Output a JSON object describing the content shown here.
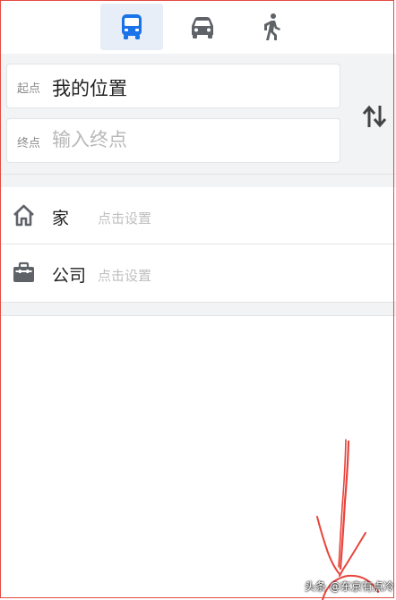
{
  "modes": [
    {
      "name": "bus",
      "icon": "bus-icon",
      "active": true
    },
    {
      "name": "car",
      "icon": "car-icon",
      "active": false
    },
    {
      "name": "walk",
      "icon": "walk-icon",
      "active": false
    }
  ],
  "route": {
    "start_label": "起点",
    "start_value": "我的位置",
    "end_label": "终点",
    "end_placeholder": "输入终点",
    "swap_icon": "swap-icon"
  },
  "shortcuts": [
    {
      "title": "家",
      "hint": "点击设置",
      "icon": "home-icon"
    },
    {
      "title": "公司",
      "hint": "点击设置",
      "icon": "briefcase-icon"
    }
  ],
  "watermark": "头条 @东京有点冷",
  "colors": {
    "accent": "#1a73e8",
    "icon_gray": "#5f6368",
    "annotation_red": "#e8453c",
    "panel_bg": "#f2f3f5"
  }
}
